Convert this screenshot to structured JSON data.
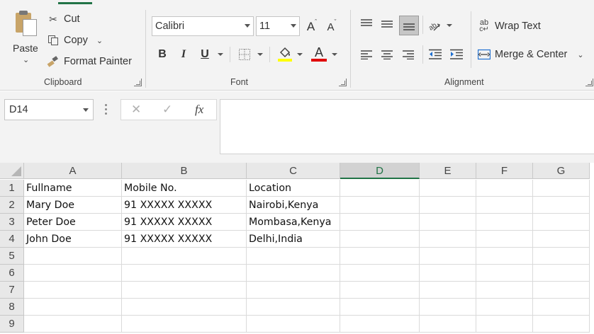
{
  "ribbon": {
    "clipboard": {
      "paste_label": "Paste",
      "cut_label": "Cut",
      "copy_label": "Copy",
      "format_painter_label": "Format Painter",
      "group_label": "Clipboard"
    },
    "font": {
      "font_name": "Calibri",
      "font_size": "11",
      "group_label": "Font",
      "bold": "B",
      "italic": "I",
      "underline": "U",
      "grow_font": "A",
      "shrink_font": "A",
      "font_color": "A",
      "highlight_color": "#ffff00",
      "text_color": "#e00000"
    },
    "alignment": {
      "wrap_text_label": "Wrap Text",
      "wrap_text_icon_glyph": "ab",
      "merge_center_label": "Merge & Center",
      "group_label": "Alignment"
    }
  },
  "formula_bar": {
    "name_box": "D14",
    "cancel_glyph": "✕",
    "enter_glyph": "✓",
    "fx_glyph": "fx",
    "formula": ""
  },
  "sheet": {
    "columns": [
      "A",
      "B",
      "C",
      "D",
      "E",
      "F",
      "G"
    ],
    "selected_column": "D",
    "rows": [
      {
        "num": "1",
        "cells": [
          "Fullname",
          "Mobile No.",
          "Location",
          "",
          "",
          "",
          ""
        ]
      },
      {
        "num": "2",
        "cells": [
          "Mary Doe",
          "91 XXXXX XXXXX",
          "Nairobi,Kenya",
          "",
          "",
          "",
          ""
        ]
      },
      {
        "num": "3",
        "cells": [
          "Peter Doe",
          "91 XXXXX XXXXX",
          "Mombasa,Kenya",
          "",
          "",
          "",
          ""
        ]
      },
      {
        "num": "4",
        "cells": [
          "John Doe",
          "91 XXXXX XXXXX",
          "Delhi,India",
          "",
          "",
          "",
          ""
        ]
      },
      {
        "num": "5",
        "cells": [
          "",
          "",
          "",
          "",
          "",
          "",
          ""
        ]
      },
      {
        "num": "6",
        "cells": [
          "",
          "",
          "",
          "",
          "",
          "",
          ""
        ]
      },
      {
        "num": "7",
        "cells": [
          "",
          "",
          "",
          "",
          "",
          "",
          ""
        ]
      },
      {
        "num": "8",
        "cells": [
          "",
          "",
          "",
          "",
          "",
          "",
          ""
        ]
      },
      {
        "num": "9",
        "cells": [
          "",
          "",
          "",
          "",
          "",
          "",
          ""
        ]
      }
    ]
  },
  "colors": {
    "accent": "#217346",
    "ribbon_bg": "#f3f3f3",
    "header_bg": "#e8e8e8"
  }
}
